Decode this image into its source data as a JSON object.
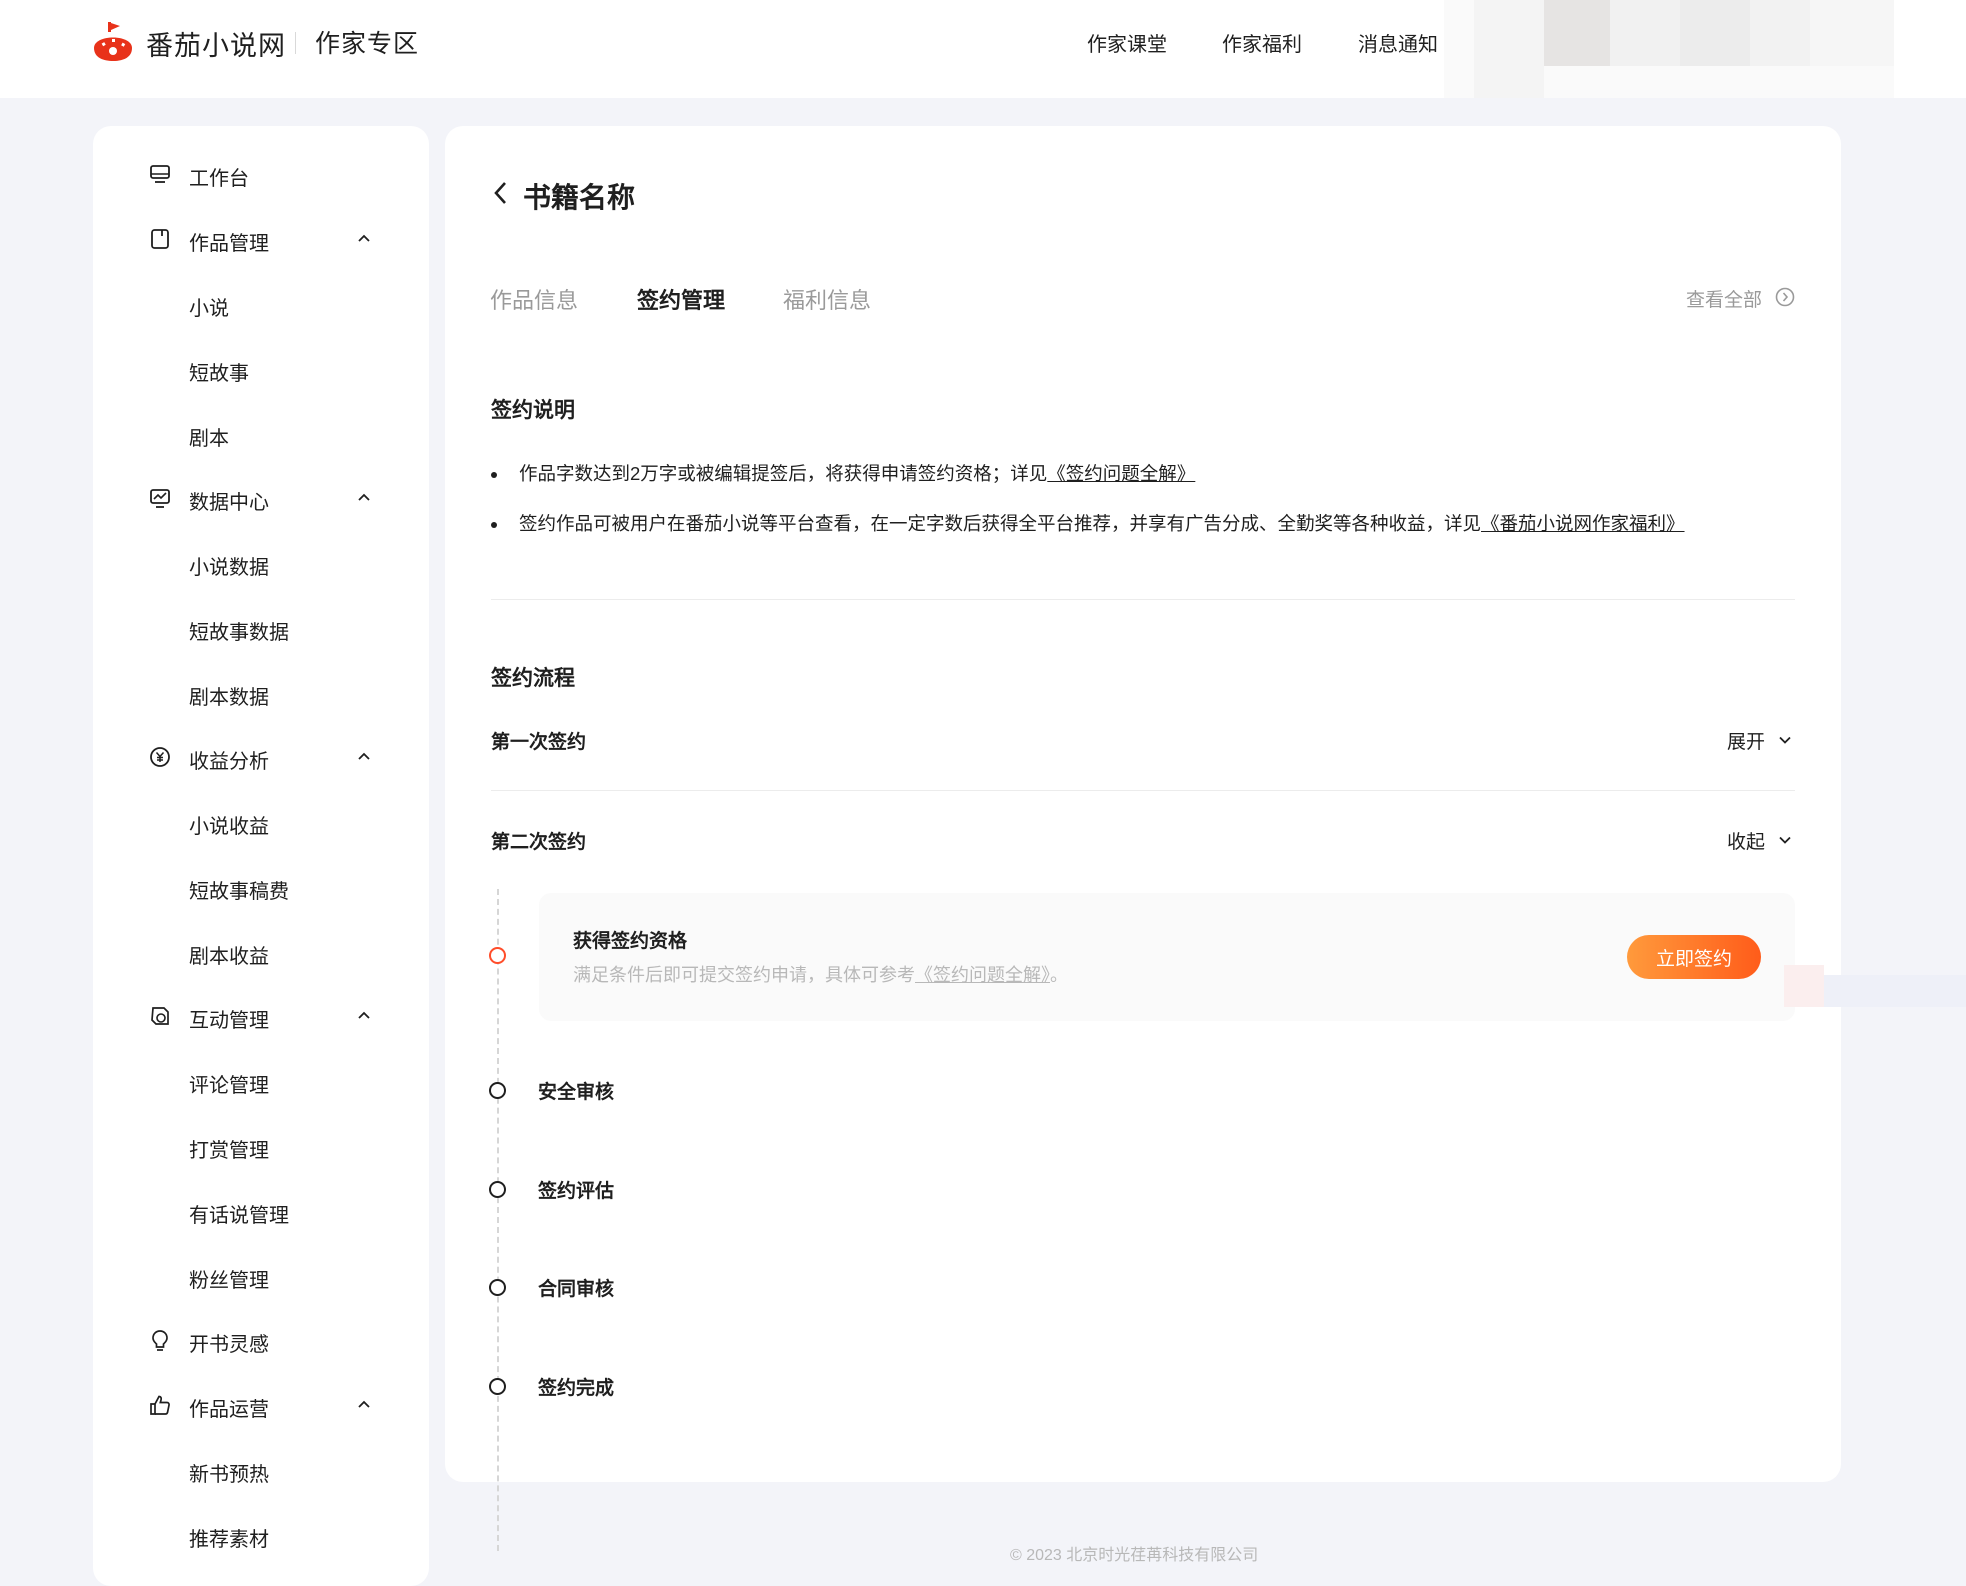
{
  "header": {
    "brand": "番茄小说网",
    "zone": "作家专区",
    "nav": [
      "作家课堂",
      "作家福利",
      "消息通知"
    ]
  },
  "sidebar": {
    "items": [
      {
        "label": "工作台",
        "icon": "monitor-icon",
        "level": 0
      },
      {
        "label": "作品管理",
        "icon": "book-icon",
        "level": 0,
        "expanded": true
      },
      {
        "label": "小说",
        "level": 1
      },
      {
        "label": "短故事",
        "level": 1
      },
      {
        "label": "剧本",
        "level": 1
      },
      {
        "label": "数据中心",
        "icon": "chart-icon",
        "level": 0,
        "expanded": true
      },
      {
        "label": "小说数据",
        "level": 1
      },
      {
        "label": "短故事数据",
        "level": 1
      },
      {
        "label": "剧本数据",
        "level": 1
      },
      {
        "label": "收益分析",
        "icon": "yuan-icon",
        "level": 0,
        "expanded": true
      },
      {
        "label": "小说收益",
        "level": 1
      },
      {
        "label": "短故事稿费",
        "level": 1
      },
      {
        "label": "剧本收益",
        "level": 1
      },
      {
        "label": "互动管理",
        "icon": "interaction-icon",
        "level": 0,
        "expanded": true
      },
      {
        "label": "评论管理",
        "level": 1
      },
      {
        "label": "打赏管理",
        "level": 1
      },
      {
        "label": "有话说管理",
        "level": 1
      },
      {
        "label": "粉丝管理",
        "level": 1
      },
      {
        "label": "开书灵感",
        "icon": "bulb-icon",
        "level": 0
      },
      {
        "label": "作品运营",
        "icon": "thumb-up-icon",
        "level": 0,
        "expanded": true
      },
      {
        "label": "新书预热",
        "level": 1
      },
      {
        "label": "推荐素材",
        "level": 1
      }
    ]
  },
  "main": {
    "title": "书籍名称",
    "tabs": [
      "作品信息",
      "签约管理",
      "福利信息"
    ],
    "active_tab": "签约管理",
    "view_all": "查看全部",
    "sign_intro": {
      "title": "签约说明",
      "bullets": [
        {
          "text": "作品字数达到2万字或被编辑提签后，将获得申请签约资格；详见",
          "link": "《签约问题全解》"
        },
        {
          "text": "签约作品可被用户在番茄小说等平台查看，在一定字数后获得全平台推荐，并享有广告分成、全勤奖等各种收益，详见",
          "link": "《番茄小说网作家福利》"
        }
      ]
    },
    "flow": {
      "title": "签约流程",
      "first": {
        "label": "第一次签约",
        "toggle": "展开"
      },
      "second": {
        "label": "第二次签约",
        "toggle": "收起"
      },
      "current_step": {
        "title": "获得签约资格",
        "desc": "满足条件后即可提交签约申请，具体可参考",
        "link": "《签约问题全解》",
        "suffix": "。",
        "button": "立即签约"
      },
      "steps": [
        "安全审核",
        "签约评估",
        "合同审核",
        "签约完成"
      ]
    }
  },
  "footer": "© 2023 北京时光荏苒科技有限公司",
  "colors": {
    "accent": "#ff5c1a",
    "accent_light": "#ff9a3c",
    "background": "#f3f4f9"
  }
}
